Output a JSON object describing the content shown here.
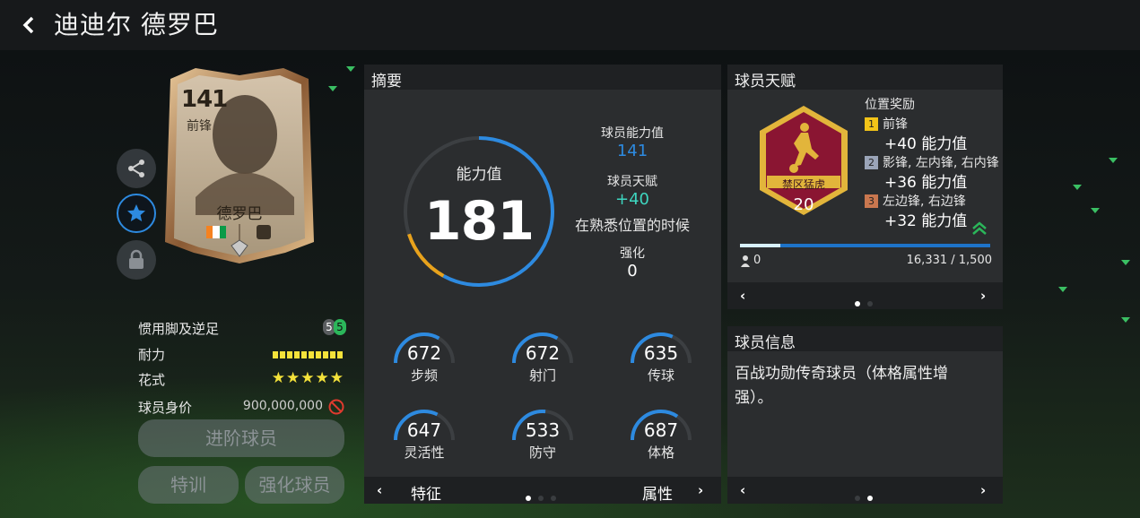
{
  "header": {
    "title": "迪迪尔 德罗巴"
  },
  "card": {
    "rating": "141",
    "position": "前锋",
    "name": "德罗巴"
  },
  "player_info_left": {
    "foot_label": "惯用脚及逆足",
    "foot_values": [
      "5",
      "5"
    ],
    "stamina_label": "耐力",
    "skill_label": "花式",
    "skill_stars": "★★★★★",
    "price_label": "球员身价",
    "price_value": "900,000,000"
  },
  "buttons": {
    "advance": "进阶球员",
    "training": "特训",
    "enhance": "强化球员"
  },
  "summary": {
    "title": "摘要",
    "ovr_label": "能力值",
    "ovr_value": "181",
    "player_ovr_label": "球员能力值",
    "player_ovr_value": "141",
    "talent_label": "球员天赋",
    "talent_value": "+40",
    "talent_note": "在熟悉位置的时候",
    "enhance_label": "强化",
    "enhance_value": "0",
    "stats": [
      {
        "value": "672",
        "label": "步频",
        "fraction": 0.67
      },
      {
        "value": "672",
        "label": "射门",
        "fraction": 0.67
      },
      {
        "value": "635",
        "label": "传球",
        "fraction": 0.63
      },
      {
        "value": "647",
        "label": "灵活性",
        "fraction": 0.65
      },
      {
        "value": "533",
        "label": "防守",
        "fraction": 0.53
      },
      {
        "value": "687",
        "label": "体格",
        "fraction": 0.69
      }
    ],
    "footer_left": "特征",
    "footer_right": "属性",
    "ovr_gauge": {
      "blue_fraction": 0.58,
      "orange_fraction": 0.12
    }
  },
  "talent": {
    "title": "球员天赋",
    "badge_name": "禁区猛虎",
    "badge_level": "20",
    "bonus_title": "位置奖励",
    "bonuses": [
      {
        "rank": "1",
        "positions": "前锋",
        "amount": "+40 能力值",
        "color": "#f2c318"
      },
      {
        "rank": "2",
        "positions": "影锋, 左内锋, 右内锋",
        "amount": "+36 能力值",
        "color": "#9aa4b8"
      },
      {
        "rank": "3",
        "positions": "左边锋, 右边锋",
        "amount": "+32 能力值",
        "color": "#c9774f"
      }
    ],
    "progress_left": "0",
    "progress_right": "16,331 / 1,500",
    "progress_fraction": 0.16
  },
  "player_desc": {
    "title": "球员信息",
    "text": "百战功勋传奇球员（体格属性增强）。"
  },
  "colors": {
    "accent_blue": "#2d8ae0",
    "accent_orange": "#e8a21c",
    "accent_teal": "#3ed6c0",
    "badge_crimson": "#8a1532",
    "badge_gold": "#e2b53b"
  }
}
